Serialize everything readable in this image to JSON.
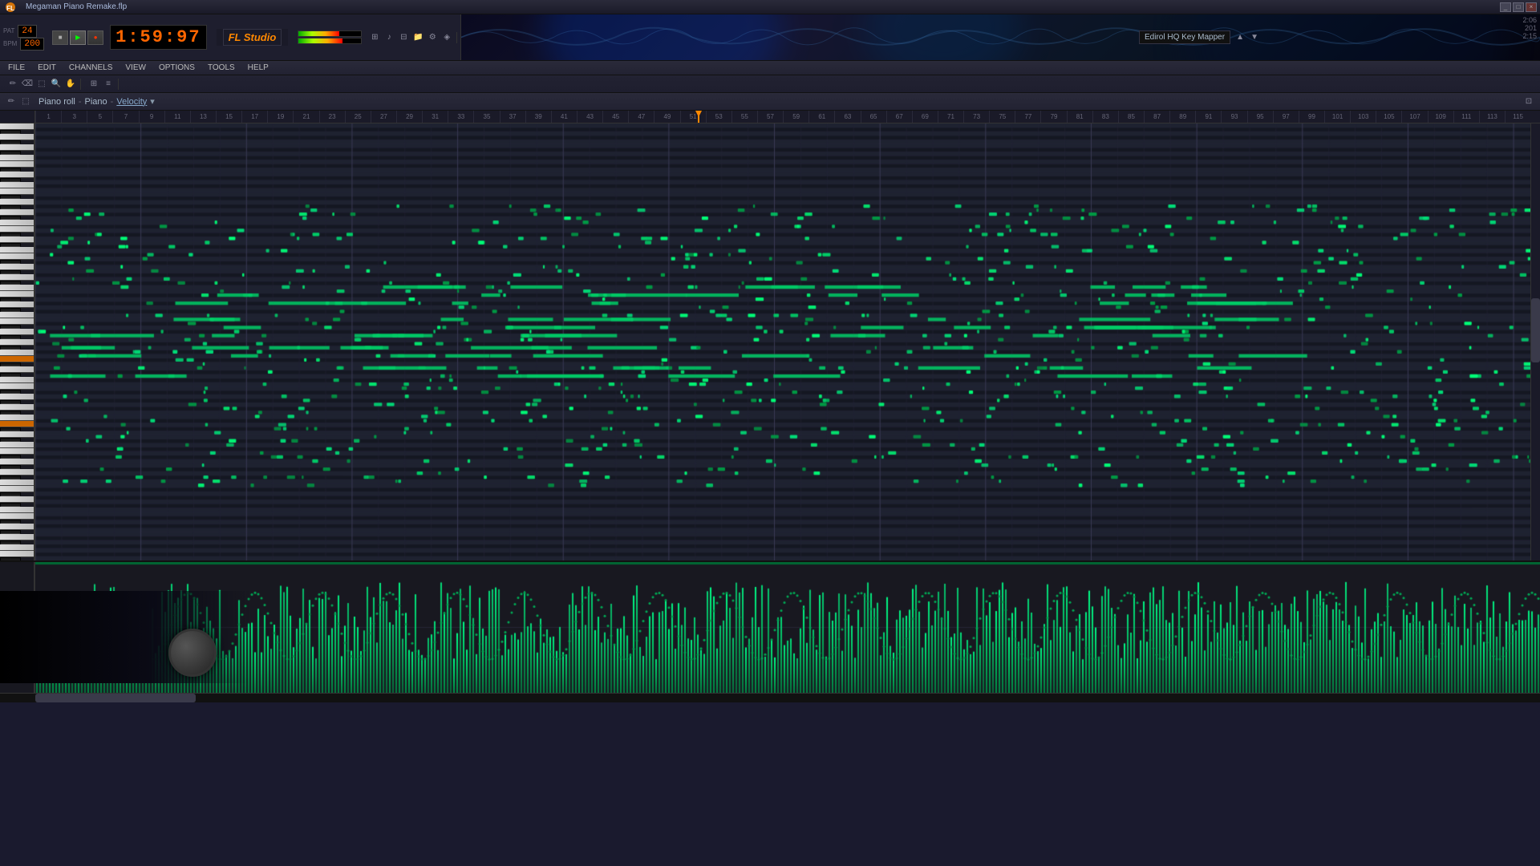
{
  "titlebar": {
    "logo": "Image-Line",
    "title": "Megaman Piano Remake.flp",
    "winbtns": [
      "_",
      "□",
      "×"
    ]
  },
  "transport": {
    "time": "1:59:97",
    "bpm": "200",
    "pattern": "24"
  },
  "menubar": {
    "items": [
      "FILE",
      "EDIT",
      "CHANNELS",
      "VIEW",
      "OPTIONS",
      "TOOLS",
      "HELP"
    ]
  },
  "pianoroll": {
    "title": "Piano roll",
    "instrument": "Piano",
    "mode": "Velocity"
  },
  "toolbar": {
    "mode_label": "Velocity"
  },
  "ruler": {
    "ticks": [
      "1",
      "3",
      "5",
      "7",
      "9",
      "11",
      "13",
      "15",
      "17",
      "19",
      "21",
      "23",
      "25",
      "27",
      "29",
      "31",
      "33",
      "35",
      "37",
      "39",
      "41",
      "43",
      "45",
      "47",
      "49",
      "51",
      "53",
      "55",
      "57",
      "59",
      "61",
      "63",
      "65",
      "67",
      "69",
      "71",
      "73",
      "75",
      "77",
      "79",
      "81",
      "83",
      "85",
      "87",
      "89",
      "91",
      "93",
      "95",
      "97",
      "99",
      "101",
      "103",
      "105",
      "107",
      "109",
      "111",
      "113",
      "115"
    ]
  }
}
